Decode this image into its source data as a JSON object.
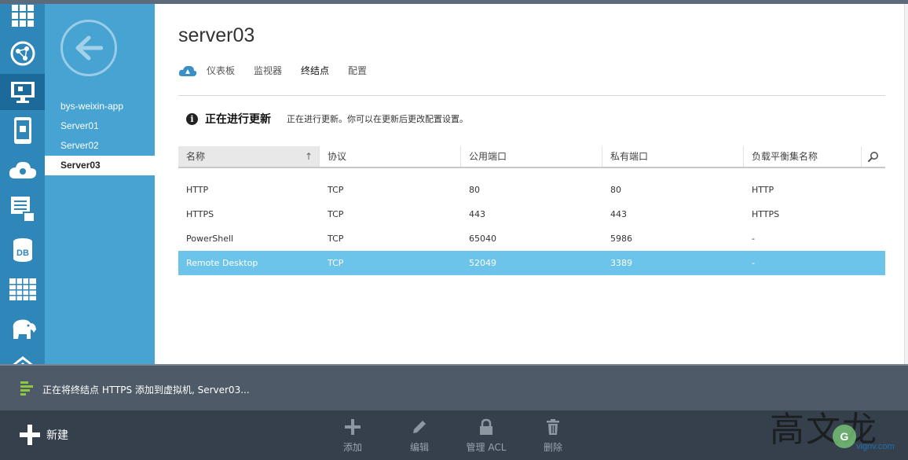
{
  "page": {
    "title": "server03"
  },
  "tabs": [
    {
      "label": "仪表板"
    },
    {
      "label": "监视器"
    },
    {
      "label": "终结点"
    },
    {
      "label": "配置"
    }
  ],
  "active_tab": "终结点",
  "subnav": {
    "items": [
      {
        "label": "bys-weixin-app"
      },
      {
        "label": "Server01"
      },
      {
        "label": "Server02"
      },
      {
        "label": "Server03"
      }
    ]
  },
  "rail": {
    "icons": [
      "grid-icon",
      "globe-icon",
      "virtual-machine-icon",
      "mobile-service-icon",
      "cloud-service-icon",
      "storage-icon",
      "sql-database-icon",
      "table-icon",
      "hdinsight-elephant-icon",
      "network-icon"
    ]
  },
  "notice": {
    "title": "正在进行更新",
    "text": "正在进行更新。你可以在更新后更改配置设置。"
  },
  "table": {
    "columns": [
      "名称",
      "协议",
      "公用端口",
      "私有端口",
      "负载平衡集名称"
    ],
    "rows": [
      {
        "name": "HTTP",
        "protocol": "TCP",
        "public_port": "80",
        "private_port": "80",
        "lb_set": "HTTP"
      },
      {
        "name": "HTTPS",
        "protocol": "TCP",
        "public_port": "443",
        "private_port": "443",
        "lb_set": "HTTPS"
      },
      {
        "name": "PowerShell",
        "protocol": "TCP",
        "public_port": "65040",
        "private_port": "5986",
        "lb_set": "-"
      },
      {
        "name": "Remote Desktop",
        "protocol": "TCP",
        "public_port": "52049",
        "private_port": "3389",
        "lb_set": "-"
      }
    ],
    "selected_row": "Remote Desktop"
  },
  "status": {
    "text": "正在将终结点 HTTPS 添加到虚拟机, Server03..."
  },
  "command_bar": {
    "new_label": "新建",
    "commands": [
      {
        "label": "添加",
        "icon": "plus-icon"
      },
      {
        "label": "编辑",
        "icon": "pencil-icon"
      },
      {
        "label": "管理 ACL",
        "icon": "lock-icon"
      },
      {
        "label": "删除",
        "icon": "trash-icon"
      }
    ]
  },
  "watermark": {
    "text": "高文龙",
    "logo": "G",
    "url": "vignv.com"
  },
  "colors": {
    "rail": "#2f86b8",
    "subnav": "#46a3d2",
    "selected_row": "#6cc4ea",
    "status_bar": "#4e5a67",
    "command_bar": "#35404c"
  }
}
